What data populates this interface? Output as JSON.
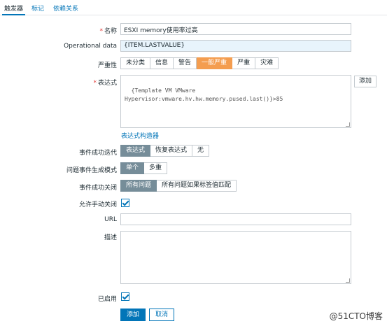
{
  "tabs": [
    {
      "label": "触发器"
    },
    {
      "label": "标记"
    },
    {
      "label": "依赖关系"
    }
  ],
  "form": {
    "name": {
      "label": "名称",
      "value": "ESXI memory使用率过高"
    },
    "opdata": {
      "label": "Operational data",
      "value": "{ITEM.LASTVALUE}"
    },
    "severity": {
      "label": "严重性",
      "options": [
        "未分类",
        "信息",
        "警告",
        "一般严重",
        "严重",
        "灾难"
      ],
      "selected": "一般严重"
    },
    "expression": {
      "label": "表达式",
      "value": "{Template VM VMware Hypervisor:vmware.hv.hw.memory.pused.last()}>85",
      "add_label": "添加",
      "builder_link": "表达式构造器"
    },
    "ok_event": {
      "label": "事件成功迭代",
      "options": [
        "表达式",
        "恢复表达式",
        "无"
      ],
      "selected": "表达式"
    },
    "problem_mode": {
      "label": "问题事件生成模式",
      "options": [
        "单个",
        "多重"
      ],
      "selected": "单个"
    },
    "ok_close": {
      "label": "事件成功关闭",
      "options": [
        "所有问题",
        "所有问题如果标签值匹配"
      ],
      "selected": "所有问题"
    },
    "manual_close": {
      "label": "允许手动关闭",
      "checked": true
    },
    "url": {
      "label": "URL",
      "value": ""
    },
    "description": {
      "label": "描述",
      "value": ""
    },
    "enabled": {
      "label": "已启用",
      "checked": true
    }
  },
  "actions": {
    "add": "添加",
    "cancel": "取消"
  },
  "watermark": "@51CTO博客",
  "colors": {
    "accent": "#0275b8",
    "selected_segment": "#768d99",
    "severity_average": "#f49d4f"
  }
}
